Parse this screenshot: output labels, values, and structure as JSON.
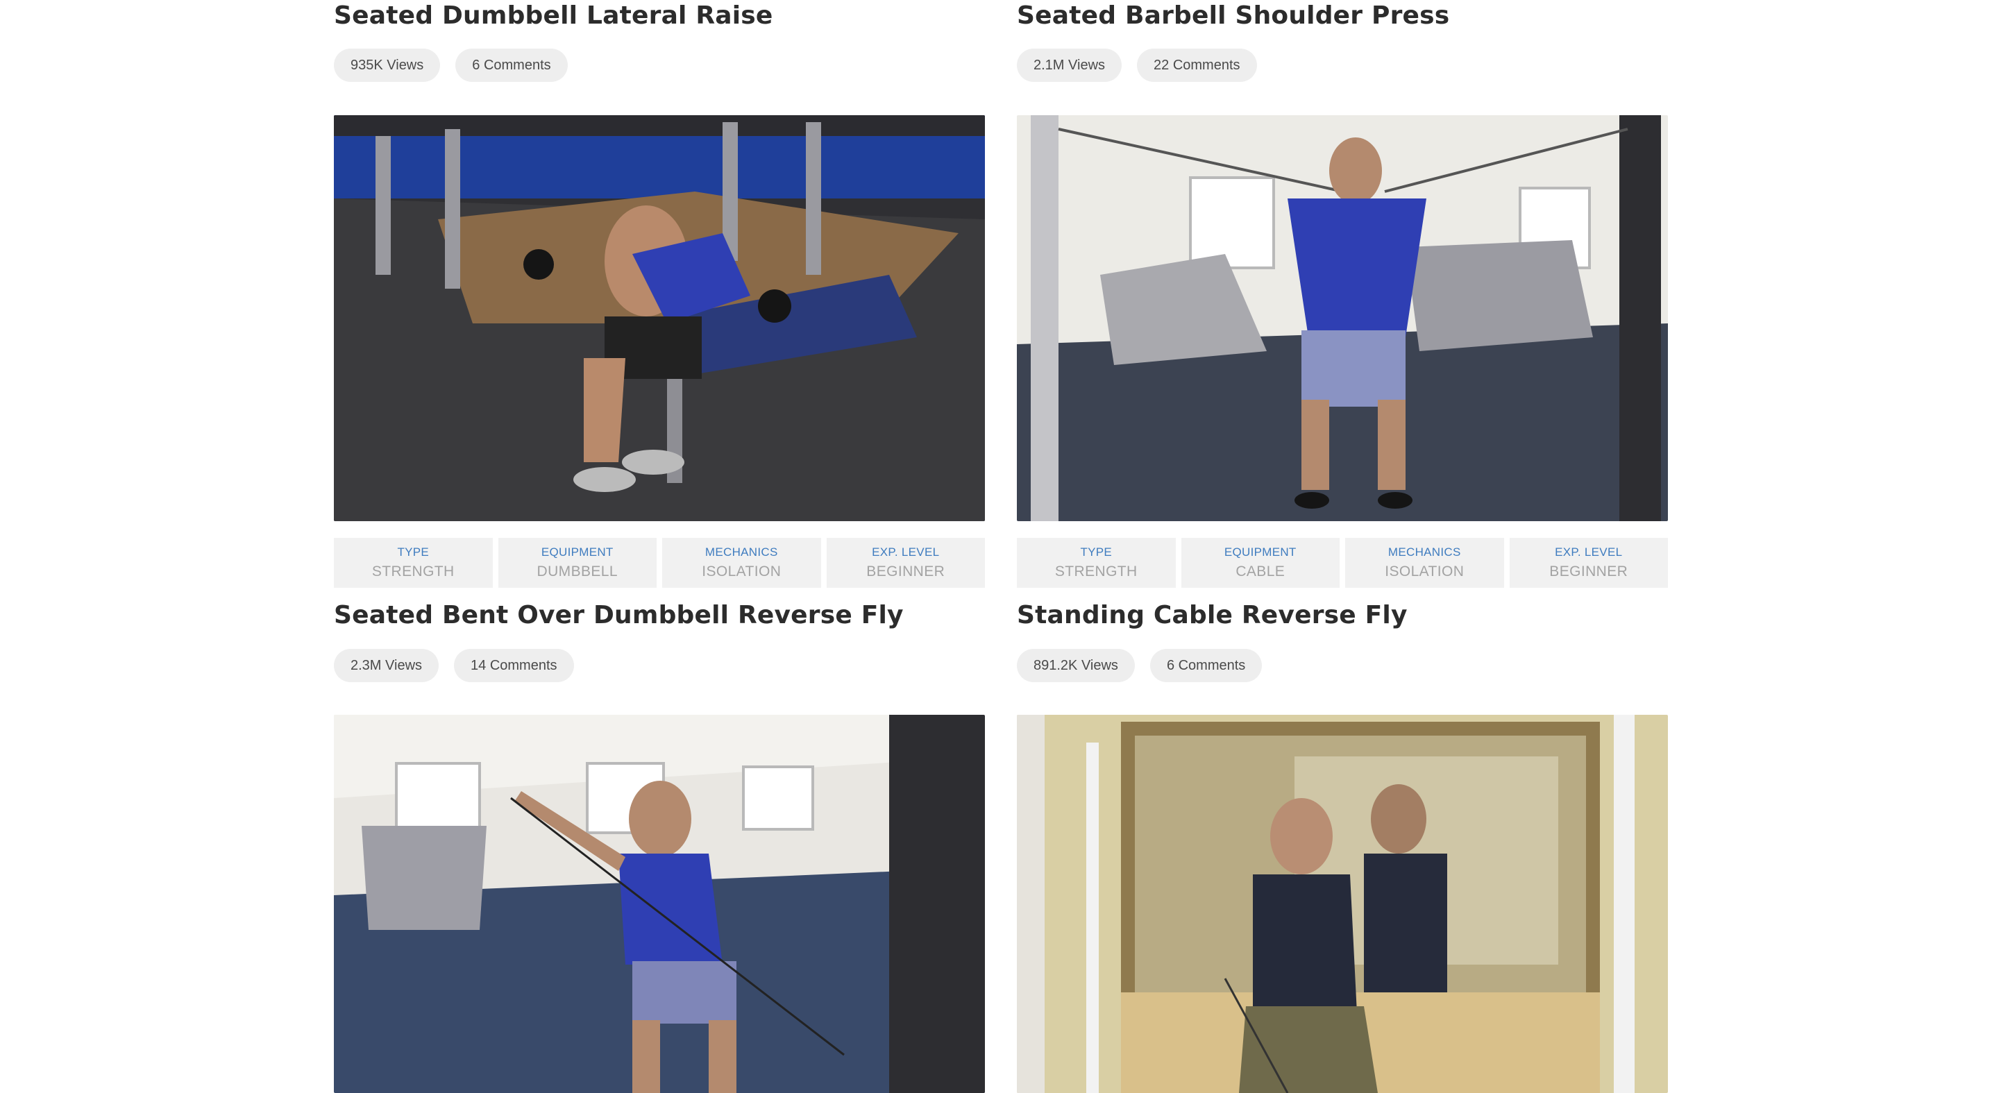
{
  "exercises": [
    {
      "title": "Seated Dumbbell Lateral Raise",
      "views": "935K Views",
      "comments": "6 Comments",
      "image_alt": "Man in blue tank top performing seated dumbbell lateral raise on a gym bench",
      "attributes": [
        {
          "label": "Type",
          "value": "Strength"
        },
        {
          "label": "Equipment",
          "value": "Dumbbell"
        },
        {
          "label": "Mechanics",
          "value": "Isolation"
        },
        {
          "label": "Exp. Level",
          "value": "Beginner"
        }
      ]
    },
    {
      "title": "Seated Barbell Shoulder Press",
      "views": "2.1M Views",
      "comments": "22 Comments",
      "image_alt": "Man in blue tank top pulling cable handles in front of chest in a gym",
      "attributes": [
        {
          "label": "Type",
          "value": "Strength"
        },
        {
          "label": "Equipment",
          "value": "Cable"
        },
        {
          "label": "Mechanics",
          "value": "Isolation"
        },
        {
          "label": "Exp. Level",
          "value": "Beginner"
        }
      ]
    },
    {
      "title": "Seated Bent Over Dumbbell Reverse Fly",
      "views": "2.3M Views",
      "comments": "14 Comments",
      "image_alt": "Man in blue tank top performing single-arm cable lateral raise"
    },
    {
      "title": "Standing Cable Reverse Fly",
      "views": "891.2K Views",
      "comments": "6 Comments",
      "image_alt": "Man in dark tank top and camo pants holding cable handle in front of gym mirror"
    }
  ]
}
